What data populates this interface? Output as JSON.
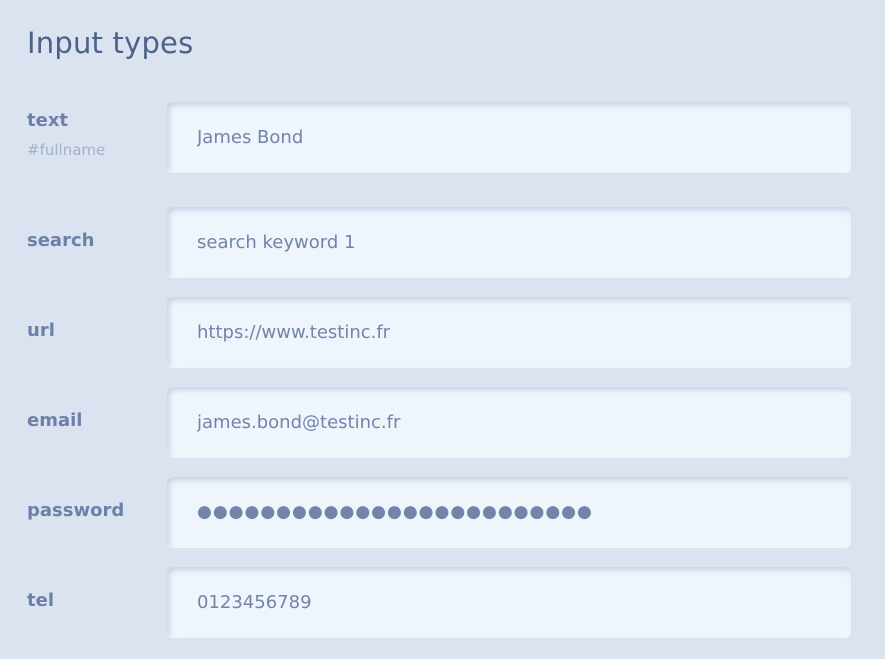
{
  "page": {
    "title": "Input types"
  },
  "fields": [
    {
      "label": "text",
      "sublabel": "#fullname",
      "type": "text",
      "value": "James Bond"
    },
    {
      "label": "search",
      "type": "search",
      "value": "search keyword 1"
    },
    {
      "label": "url",
      "type": "url",
      "value": "https://www.testinc.fr"
    },
    {
      "label": "email",
      "type": "email",
      "value": "james.bond@testinc.fr"
    },
    {
      "label": "password",
      "type": "password",
      "value": "●●●●●●●●●●●●●●●●●●●●●●●●●"
    },
    {
      "label": "tel",
      "type": "tel",
      "value": "0123456789"
    }
  ],
  "colors": {
    "background": "#dae3ef",
    "field_background": "#eff5fd",
    "title": "#4e6189",
    "label": "#6d80a9",
    "sublabel": "#a4b1ca",
    "value_text": "#7384a8"
  }
}
